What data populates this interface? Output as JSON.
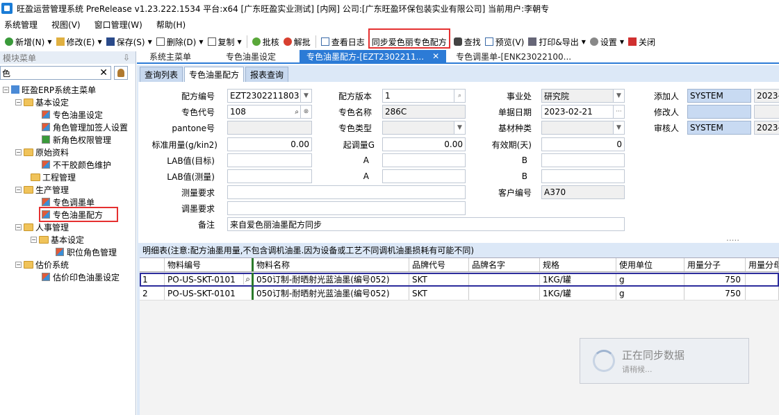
{
  "window": {
    "title": "旺盈运营管理系统 PreRelease v1.23.222.1534 平台:x64  [广东旺盈实业测试] [内网] 公司:[广东旺盈环保包装实业有限公司] 当前用户:李朝专"
  },
  "menu": [
    "系统管理",
    "视图(V)",
    "窗口管理(W)",
    "帮助(H)"
  ],
  "toolbar": {
    "add": "新增(N)",
    "edit": "修改(E)",
    "save": "保存(S)",
    "delete": "删除(D)",
    "copy": "复制",
    "approve": "批核",
    "unapprove": "解批",
    "log": "查看日志",
    "sync": "同步爱色丽专色配方",
    "find": "查找",
    "preview": "预览(V)",
    "print": "打印&导出",
    "settings": "设置",
    "close": "关闭"
  },
  "sidebar": {
    "header": "模块菜单",
    "pin": "⇩",
    "search_value": "色",
    "tree": {
      "root": "旺盈ERP系统主菜单",
      "basic": "基本设定",
      "spot_ink_setting": "专色油墨设定",
      "role_mgmt": "角色管理加签人设置",
      "new_role_perm": "新角色权限管理",
      "raw_material": "原始资料",
      "dry_color": "不干胶颜色维护",
      "engineering": "工程管理",
      "production": "生产管理",
      "spot_mix_order": "专色调墨单",
      "spot_ink_formula": "专色油墨配方",
      "hr": "人事管理",
      "hr_basic": "基本设定",
      "job_role": "职位角色管理",
      "pricing": "估价系统",
      "print_ink": "估价印色油墨设定"
    }
  },
  "main_tabs": [
    "系统主菜单",
    "专色油墨设定",
    "专色油墨配方-[EZT2302211...",
    "专色调墨单-[ENK23022100..."
  ],
  "sub_tabs": [
    "查询列表",
    "专色油墨配方",
    "报表查询"
  ],
  "form": {
    "formula_no_label": "配方编号",
    "formula_no": "EZT2302211803",
    "version_label": "配方版本",
    "version": "1",
    "division_label": "事业处",
    "division": "研究院",
    "added_by_label": "添加人",
    "added_by": "SYSTEM",
    "added_date": "2023-",
    "spot_code_label": "专色代号",
    "spot_code": "108",
    "spot_name_label": "专色名称",
    "spot_name": "286C",
    "doc_date_label": "单据日期",
    "doc_date": "2023-02-21",
    "modified_by_label": "修改人",
    "modified_by": "",
    "pantone_label": "pantone号",
    "pantone": "",
    "spot_type_label": "专色类型",
    "spot_type": "",
    "substrate_label": "基材种类",
    "substrate": "",
    "approver_label": "审核人",
    "approver": "SYSTEM",
    "approve_date": "2023-",
    "std_usage_label": "标准用量(g/kin2)",
    "std_usage": "0.00",
    "start_mix_label": "起调量G",
    "start_mix": "0.00",
    "validity_label": "有效期(天)",
    "validity": "0",
    "lab_target_label": "LAB值(目标)",
    "lab_measured_label": "LAB值(测量)",
    "a_label": "A",
    "b_label": "B",
    "measure_req_label": "测量要求",
    "measure_req": "",
    "customer_no_label": "客户编号",
    "customer_no": "A370",
    "mix_req_label": "调墨要求",
    "mix_req": "",
    "remark_label": "备注",
    "remark": "来自爱色丽油墨配方同步",
    "more": "....."
  },
  "detail": {
    "title": "明细表(注意:配方油墨用量,不包含调机油墨.因为设备或工艺不同调机油墨损耗有可能不同)",
    "columns": [
      "",
      "物料编号",
      "物料名称",
      "品牌代号",
      "品牌名字",
      "规格",
      "使用单位",
      "用量分子",
      "用量分母"
    ],
    "rows": [
      [
        "1",
        "PO-US-SKT-0101",
        "050订制-耐晒射光蓝油墨(编号052)",
        "SKT",
        "",
        "1KG/罐",
        "g",
        "750",
        ""
      ],
      [
        "2",
        "PO-US-SKT-0101",
        "050订制-耐晒射光蓝油墨(编号052)",
        "SKT",
        "",
        "1KG/罐",
        "g",
        "750",
        ""
      ]
    ]
  },
  "sync_status": {
    "title": "正在同步数据",
    "subtitle": "请稍候..."
  }
}
